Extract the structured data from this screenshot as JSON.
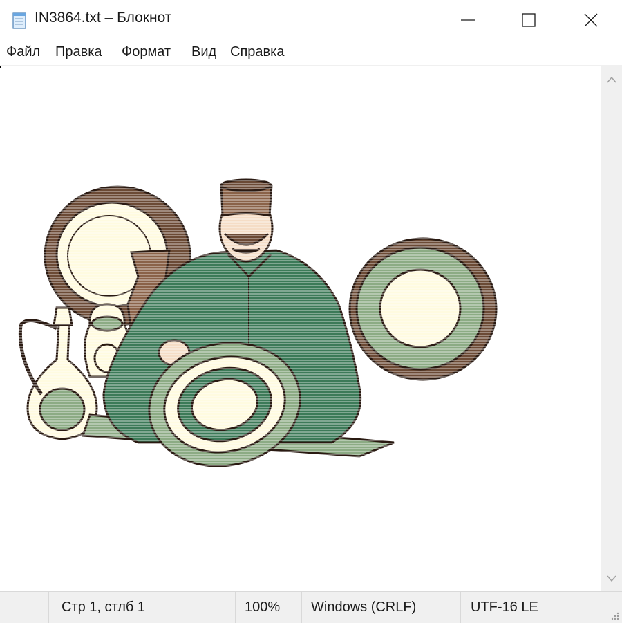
{
  "window": {
    "title": "IN3864.txt – Блокнот",
    "icons": {
      "app": "notepad-icon",
      "minimize": "minimize-icon",
      "maximize": "maximize-icon",
      "close": "close-icon"
    }
  },
  "menu": {
    "items": [
      {
        "label": "Файл"
      },
      {
        "label": "Правка"
      },
      {
        "label": "Формат"
      },
      {
        "label": "Вид"
      },
      {
        "label": "Справка"
      }
    ]
  },
  "editor": {
    "content_image": "ascii-art-craftsman-with-pottery-and-plates"
  },
  "statusbar": {
    "position": "Стр 1, стлб 1",
    "zoom": "100%",
    "line_ending": "Windows (CRLF)",
    "encoding": "UTF-16 LE"
  },
  "colors": {
    "green": "#3c7a58",
    "light_green": "#8cab84",
    "brown": "#6b4a35",
    "cream": "#fffbe0",
    "skin": "#f5ddc6"
  }
}
